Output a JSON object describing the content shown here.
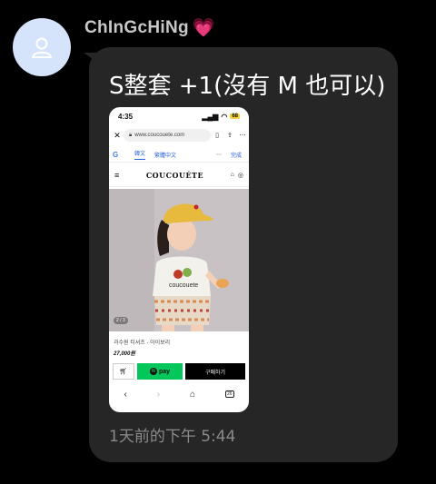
{
  "sender": {
    "name": "ChInGcHiNg",
    "emoji": "💗"
  },
  "message": {
    "text": "S整套 +1(沒有 M 也可以)",
    "timestamp": "1天前的下午 5:44"
  },
  "screenshot": {
    "status_time": "4:35",
    "battery": "68",
    "url": "www.coucouete.com",
    "translate": {
      "tab_original": "韓文",
      "tab_translated": "繁體中文",
      "more": "⋯",
      "done": "完成"
    },
    "brand": "COUCOUÉTE",
    "shirt_text": "coucouete",
    "photo_counter": "2 / 3",
    "product_name": "과수원 티셔츠 - 아이보리",
    "product_price": "27,000원",
    "npay_label": "pay",
    "buy_label": "구매하기"
  },
  "colors": {
    "bubble": "#262626",
    "avatar_bg": "#d5e4fb",
    "npay_green": "#03c75a"
  }
}
